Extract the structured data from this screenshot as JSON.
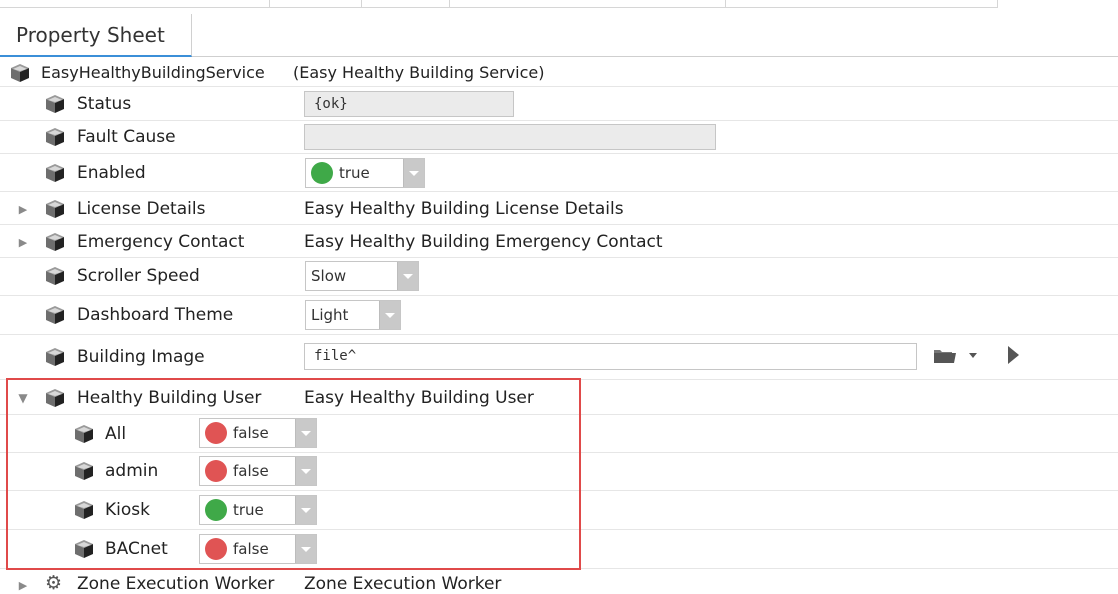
{
  "tab": {
    "label": "Property Sheet"
  },
  "root": {
    "name": "EasyHealthyBuildingService",
    "desc": "(Easy Healthy Building Service)"
  },
  "colors": {
    "green": "#3fa948",
    "red": "#e05454",
    "highlight": "#e04a4a",
    "tab_accent": "#3b8fd8"
  },
  "props": {
    "status": {
      "label": "Status",
      "value": "{ok}"
    },
    "fault_cause": {
      "label": "Fault Cause",
      "value": ""
    },
    "enabled": {
      "label": "Enabled",
      "value": "true"
    },
    "license_details": {
      "label": "License Details",
      "value": "Easy Healthy Building License Details"
    },
    "emergency_contact": {
      "label": "Emergency Contact",
      "value": "Easy Healthy Building Emergency Contact"
    },
    "scroller_speed": {
      "label": "Scroller Speed",
      "value": "Slow"
    },
    "dashboard_theme": {
      "label": "Dashboard Theme",
      "value": "Light"
    },
    "building_image": {
      "label": "Building Image",
      "value": "file^"
    },
    "healthy_building_user": {
      "label": "Healthy Building User",
      "value": "Easy Healthy Building User"
    },
    "users": [
      {
        "label": "All",
        "value": "false"
      },
      {
        "label": "admin",
        "value": "false"
      },
      {
        "label": "Kiosk",
        "value": "true"
      },
      {
        "label": "BACnet",
        "value": "false"
      }
    ],
    "zone_execution_worker": {
      "label": "Zone Execution Worker",
      "value": "Zone Execution Worker"
    }
  }
}
